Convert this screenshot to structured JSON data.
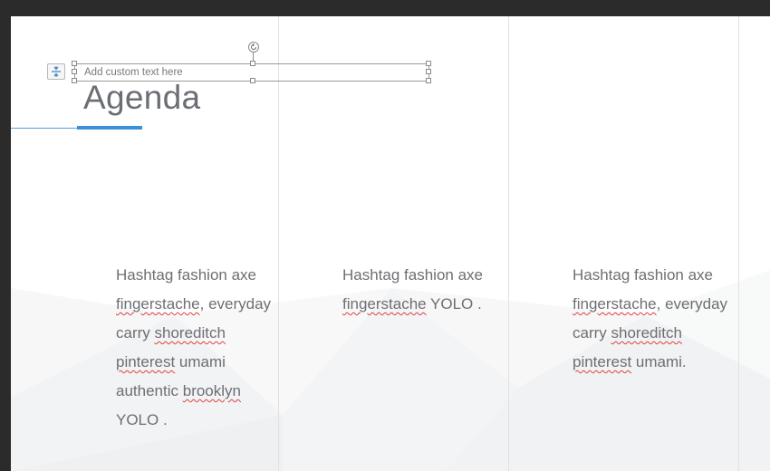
{
  "slide": {
    "title": "Agenda",
    "custom_text_placeholder": "Add custom text here",
    "accent_color": "#3d8fd8",
    "background_color": "#ffffff",
    "text_color": "#6c6f73"
  },
  "columns": [
    {
      "lines": [
        [
          {
            "text": "Hashtag fashion axe",
            "misspelled": false
          }
        ],
        [
          {
            "text": "fingerstache",
            "misspelled": true
          },
          {
            "text": ", everyday",
            "misspelled": false
          }
        ],
        [
          {
            "text": "carry ",
            "misspelled": false
          },
          {
            "text": "shoreditch",
            "misspelled": true
          }
        ],
        [
          {
            "text": "pinterest",
            "misspelled": true
          },
          {
            "text": " umami",
            "misspelled": false
          }
        ],
        [
          {
            "text": "authentic ",
            "misspelled": false
          },
          {
            "text": "brooklyn",
            "misspelled": true
          }
        ],
        [
          {
            "text": "YOLO .",
            "misspelled": false
          }
        ]
      ]
    },
    {
      "lines": [
        [
          {
            "text": "Hashtag fashion axe",
            "misspelled": false
          }
        ],
        [
          {
            "text": "fingerstache",
            "misspelled": true
          },
          {
            "text": " YOLO .",
            "misspelled": false
          }
        ]
      ]
    },
    {
      "lines": [
        [
          {
            "text": "Hashtag fashion axe",
            "misspelled": false
          }
        ],
        [
          {
            "text": "fingerstache",
            "misspelled": true
          },
          {
            "text": ", everyday",
            "misspelled": false
          }
        ],
        [
          {
            "text": "carry ",
            "misspelled": false
          },
          {
            "text": "shoreditch",
            "misspelled": true
          }
        ],
        [
          {
            "text": "pinterest",
            "misspelled": true
          },
          {
            "text": " umami.",
            "misspelled": false
          }
        ]
      ]
    }
  ],
  "icons": {
    "layout_button": "distribute-vertical-icon",
    "rotate_handle": "rotate-icon"
  }
}
